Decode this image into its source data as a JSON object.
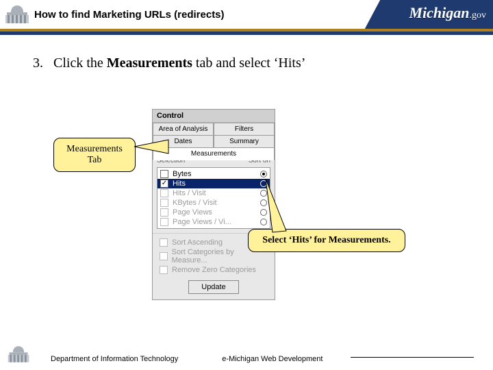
{
  "header": {
    "title": "How to find Marketing URLs (redirects)",
    "brand_name": "Michigan",
    "brand_suffix": ".gov",
    "brand_bg": "#1e3a6e",
    "brand_accent": "#b0801a"
  },
  "step": {
    "number": "3.",
    "prefix": "Click the ",
    "bold1": "Measurements",
    "mid": " tab and select ‘Hits’"
  },
  "callouts": {
    "tab_label_line1": "Measurements",
    "tab_label_line2": "Tab",
    "hits_label": "Select ‘Hits’ for Measurements."
  },
  "panel": {
    "title": "Control",
    "tabs_row1": [
      "Area of Analysis",
      "Filters"
    ],
    "tabs_row2": [
      "Dates",
      "Summary"
    ],
    "tabs_row3_selected": "Measurements",
    "col_left": "Selection",
    "col_right": "Sort on",
    "options": [
      {
        "label": "Bytes",
        "checked": false,
        "selected_radio": true,
        "gray": false
      },
      {
        "label": "Hits",
        "checked": true,
        "selected_radio": false,
        "gray": false,
        "highlighted": true
      },
      {
        "label": "Hits / Visit",
        "checked": false,
        "selected_radio": false,
        "gray": true
      },
      {
        "label": "KBytes / Visit",
        "checked": false,
        "selected_radio": false,
        "gray": true
      },
      {
        "label": "Page Views",
        "checked": false,
        "selected_radio": false,
        "gray": true
      },
      {
        "label": "Page Views / Vi...",
        "checked": false,
        "selected_radio": false,
        "gray": true
      }
    ],
    "sort_asc": "Sort Ascending",
    "sort_by_measure": "Sort Categories by Measure...",
    "remove_zero": "Remove Zero Categories",
    "update_btn": "Update"
  },
  "footer": {
    "left": "Department of Information Technology",
    "right": "e-Michigan Web Development"
  }
}
